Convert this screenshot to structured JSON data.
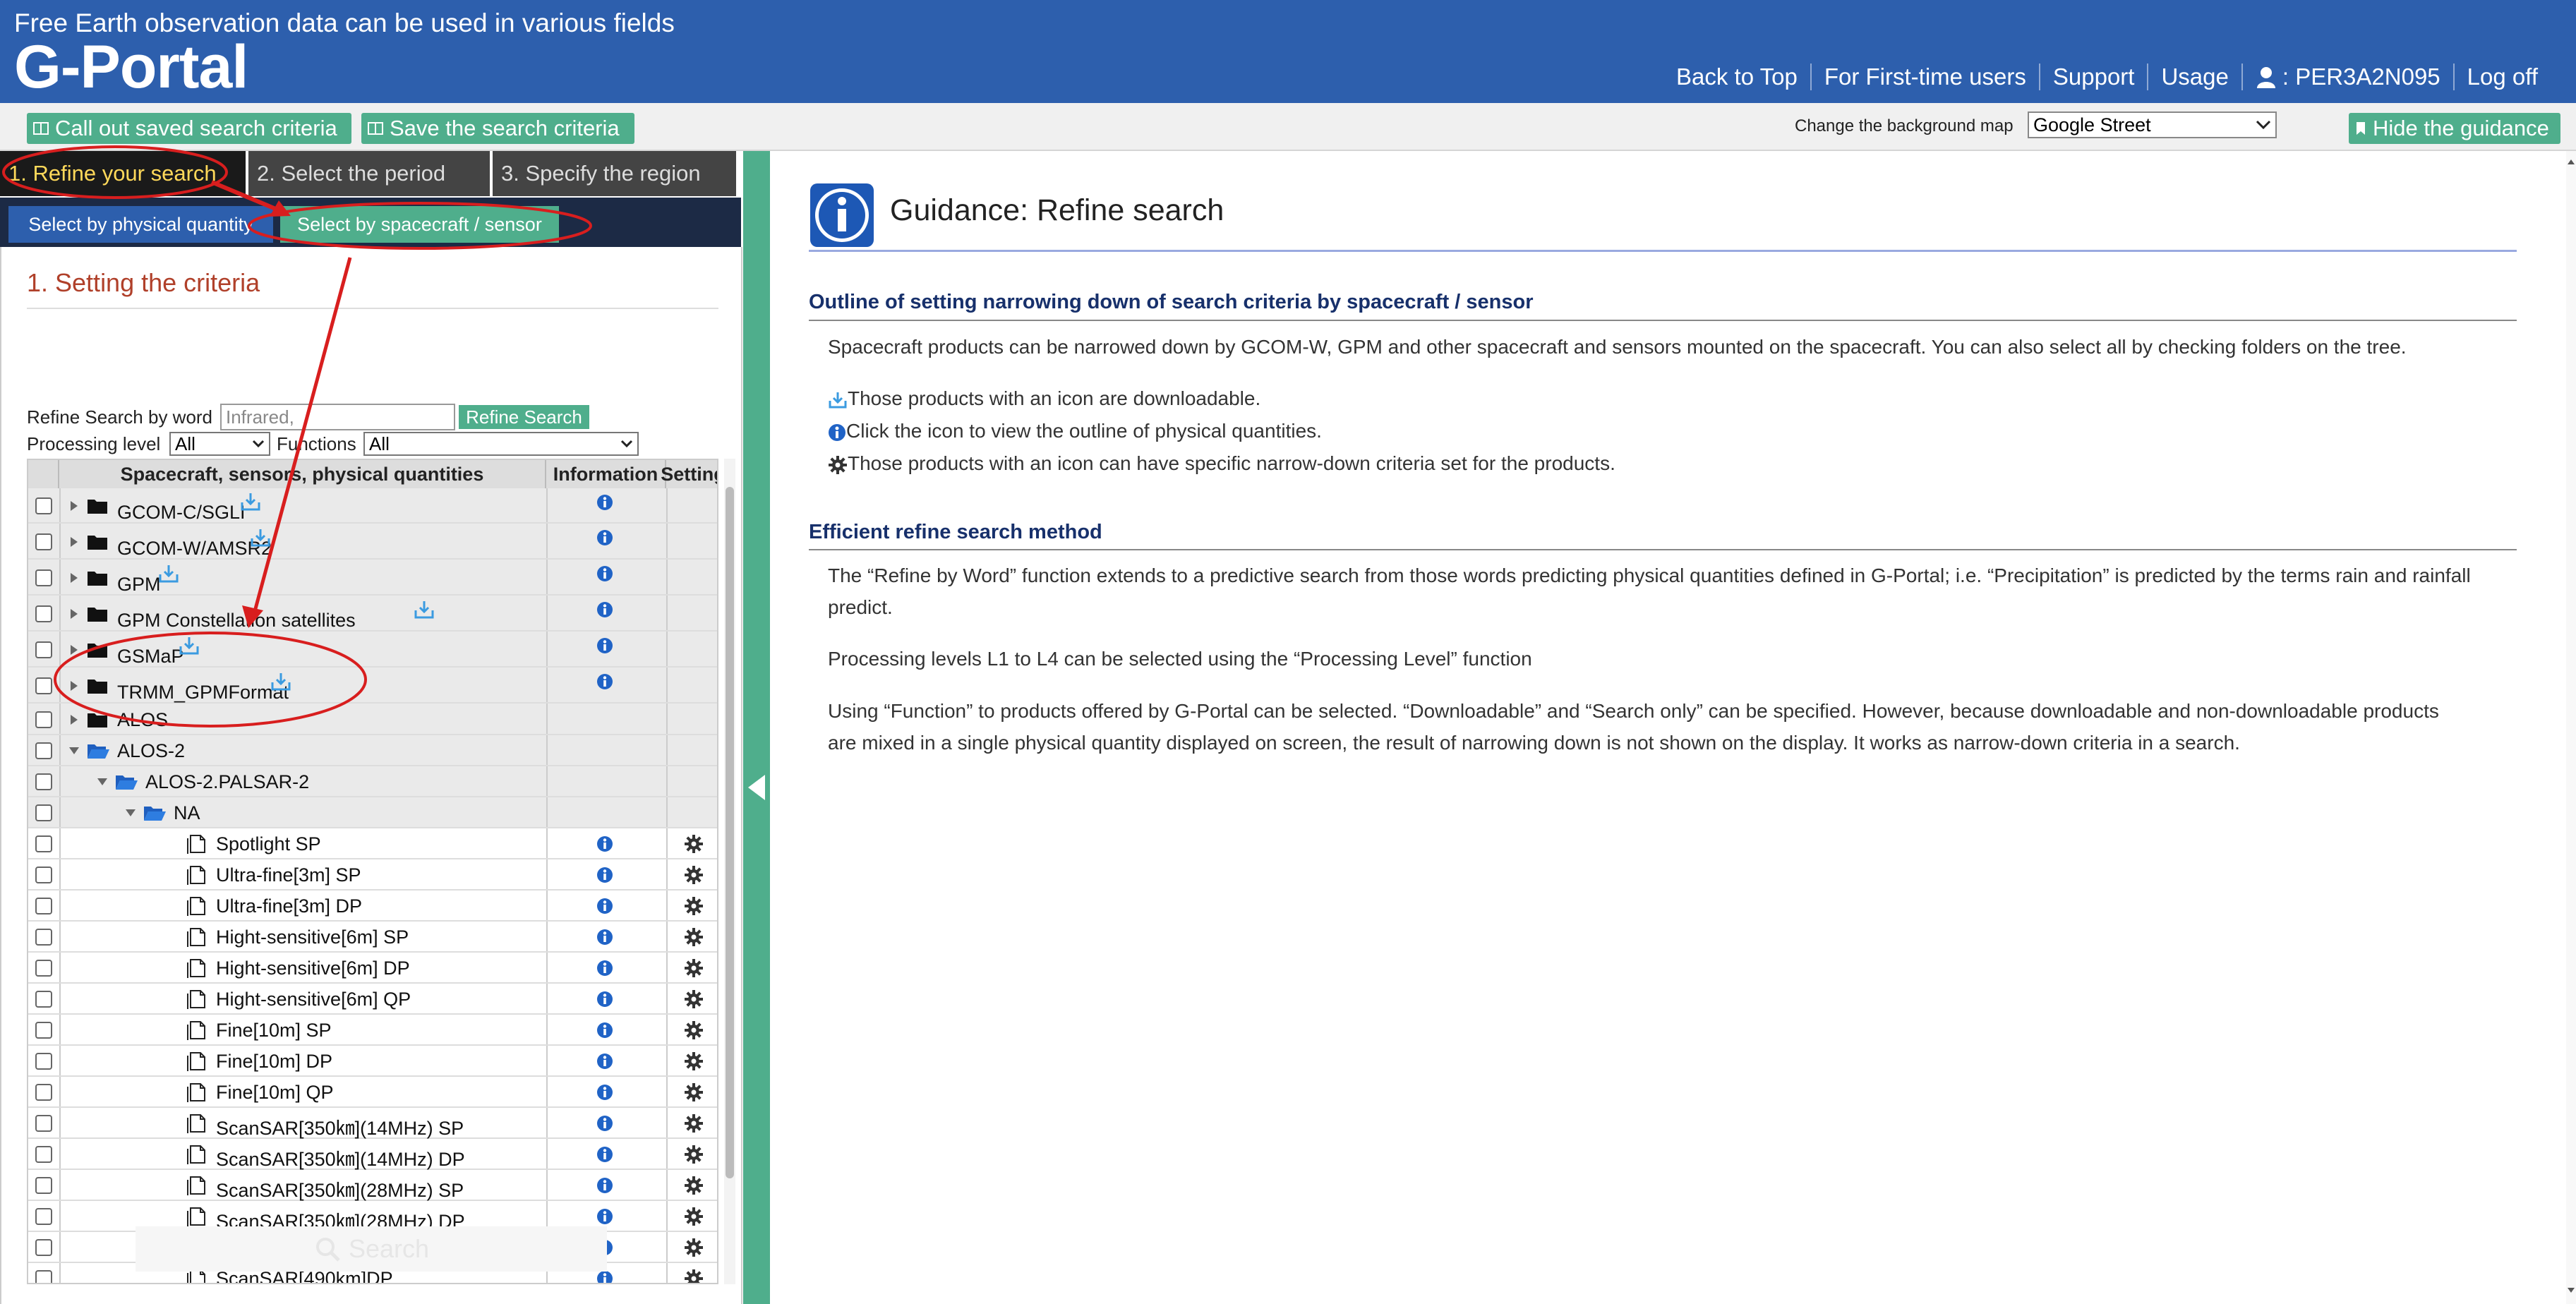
{
  "header": {
    "tagline": "Free Earth observation data can be used in various fields",
    "logo": "G-Portal",
    "nav": {
      "back_to_top": "Back to Top",
      "first_time": "For First-time users",
      "support": "Support",
      "usage": "Usage",
      "user": ": PER3A2N095",
      "logoff": "Log off"
    },
    "colors": {
      "header_bg": "#2d5fad",
      "accent_green": "#4fae8c",
      "title_red": "#b0402a"
    }
  },
  "toolbar": {
    "call_out": "Call out saved search criteria",
    "save": "Save the search criteria",
    "bgmap_label": "Change the background map",
    "bgmap_value": "Google Street",
    "hide_guidance": "Hide the guidance"
  },
  "steps": {
    "step1": "1. Refine your search",
    "step2": "2. Select the period",
    "step3": "3. Specify the region"
  },
  "subtabs": {
    "physical": "Select by physical quantity",
    "spacecraft": "Select by spacecraft / sensor"
  },
  "criteria": {
    "title": "1. Setting the criteria",
    "refine_word_label": "Refine Search by word",
    "word_placeholder": "Infrared,",
    "refine_button": "Refine Search",
    "processing_label": "Processing level",
    "processing_value": "All",
    "functions_label": "Functions",
    "functions_value": "All"
  },
  "tree": {
    "col_name": "Spacecraft, sensors, physical quantities",
    "col_info": "Information",
    "col_setting": "Setting",
    "rows": [
      {
        "name": "GCOM-C/SGLI",
        "type": "folder",
        "download": true,
        "info": true
      },
      {
        "name": "GCOM-W/AMSR2",
        "type": "folder",
        "download": true,
        "info": true
      },
      {
        "name": "GPM",
        "type": "folder",
        "download": true,
        "info": true
      },
      {
        "name": "GPM Constellation satellites",
        "type": "folder",
        "download": true,
        "info": true
      },
      {
        "name": "GSMaP",
        "type": "folder",
        "download": true,
        "info": true
      },
      {
        "name": "TRMM_GPMFormat",
        "type": "folder",
        "download": true,
        "info": true
      },
      {
        "name": "ALOS",
        "type": "folder"
      },
      {
        "name": "ALOS-2",
        "type": "folder-open"
      },
      {
        "name": "ALOS-2.PALSAR-2",
        "type": "folder-open"
      },
      {
        "name": "NA",
        "type": "folder-open"
      },
      {
        "name": "Spotlight SP",
        "type": "file"
      },
      {
        "name": "Ultra-fine[3m] SP",
        "type": "file"
      },
      {
        "name": "Ultra-fine[3m] DP",
        "type": "file"
      },
      {
        "name": "Hight-sensitive[6m] SP",
        "type": "file"
      },
      {
        "name": "Hight-sensitive[6m] DP",
        "type": "file"
      },
      {
        "name": "Hight-sensitive[6m] QP",
        "type": "file"
      },
      {
        "name": "Fine[10m] SP",
        "type": "file"
      },
      {
        "name": "Fine[10m] DP",
        "type": "file"
      },
      {
        "name": "Fine[10m] QP",
        "type": "file"
      },
      {
        "name": "ScanSAR[350㎞](14MHz) SP",
        "type": "file"
      },
      {
        "name": "ScanSAR[350㎞](14MHz) DP",
        "type": "file"
      },
      {
        "name": "ScanSAR[350㎞](28MHz) SP",
        "type": "file"
      },
      {
        "name": "ScanSAR[350㎞](28MHz) DP",
        "type": "file"
      },
      {
        "name": "ScanSAR[490km] SP",
        "type": "file"
      },
      {
        "name": "ScanSAR[490km]DP",
        "type": "file"
      }
    ]
  },
  "search_button": "Search",
  "guidance": {
    "title": "Guidance: Refine search",
    "section1": "Outline of setting narrowing down of search criteria by spacecraft / sensor",
    "s1_p1": "Spacecraft products can be narrowed down by GCOM-W, GPM and other spacecraft and sensors mounted on the spacecraft. You can also select all by checking folders on the tree.",
    "s1_dl": "Those products with an icon are downloadable.",
    "s1_info": "Click the icon to view the outline of physical quantities.",
    "s1_gear": "Those products with an icon can have specific narrow-down criteria set for the products.",
    "section2": "Efficient refine search method",
    "s2_p1": "The “Refine by Word” function extends to a predictive search from those words predicting physical quantities defined in G-Portal; i.e. “Precipitation” is predicted by the terms rain and rainfall predict.",
    "s2_p2": "Processing levels L1 to L4 can be selected using the “Processing Level” function",
    "s2_p3": "Using “Function” to products offered by G-Portal can be selected. “Downloadable” and “Search only” can be specified. However, because downloadable and non-downloadable products are mixed in a single physical quantity displayed on screen, the result of narrowing down is not shown on the display. It works as narrow-down criteria in a search."
  }
}
